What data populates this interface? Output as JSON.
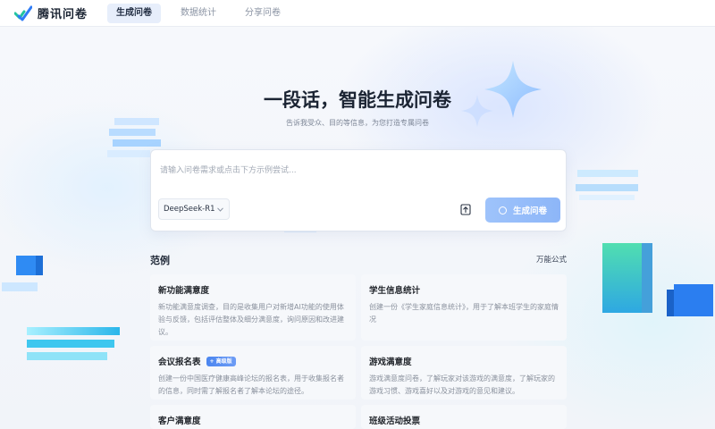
{
  "nav": {
    "brand": "腾讯问卷",
    "tabs": [
      "生成问卷",
      "数据统计",
      "分享问卷"
    ]
  },
  "hero": {
    "title": "一段话，智能生成问卷",
    "subtitle": "告诉我受众、目的等信息，为您打造专属问卷"
  },
  "prompt": {
    "placeholder": "请输入问卷需求或点击下方示例尝试...",
    "value": "",
    "model": "DeepSeek-R1",
    "generate_label": "生成问卷"
  },
  "examples": {
    "title": "范例",
    "link": "万能公式",
    "cards": [
      {
        "title": "新功能满意度",
        "badge": "",
        "desc": "新功能满意度调查，目的是收集用户对新增AI功能的使用体验与反馈，包括评估整体及细分满意度，询问原因和改进建议。"
      },
      {
        "title": "学生信息统计",
        "badge": "",
        "desc": "创建一份《学生家庭信息统计》，用于了解本班学生的家庭情况"
      },
      {
        "title": "会议报名表",
        "badge": "+ 高级版",
        "desc": "创建一份中国医疗健康高峰论坛的报名表，用于收集报名者的信息，同时需了解报名者了解本论坛的途径。"
      },
      {
        "title": "游戏满意度",
        "badge": "",
        "desc": "游戏满意度问卷，了解玩家对该游戏的满意度，了解玩家的游戏习惯、游戏喜好以及对游戏的意见和建议。"
      },
      {
        "title": "客户满意度",
        "badge": "",
        "desc": ""
      },
      {
        "title": "班级活动投票",
        "badge": "",
        "desc": ""
      }
    ]
  },
  "colors": {
    "accent": "#3b7cf4",
    "generate_button": "#9ec3fb",
    "brand_check_blue": "#2f7cf6",
    "brand_check_green": "#23c4a0"
  }
}
